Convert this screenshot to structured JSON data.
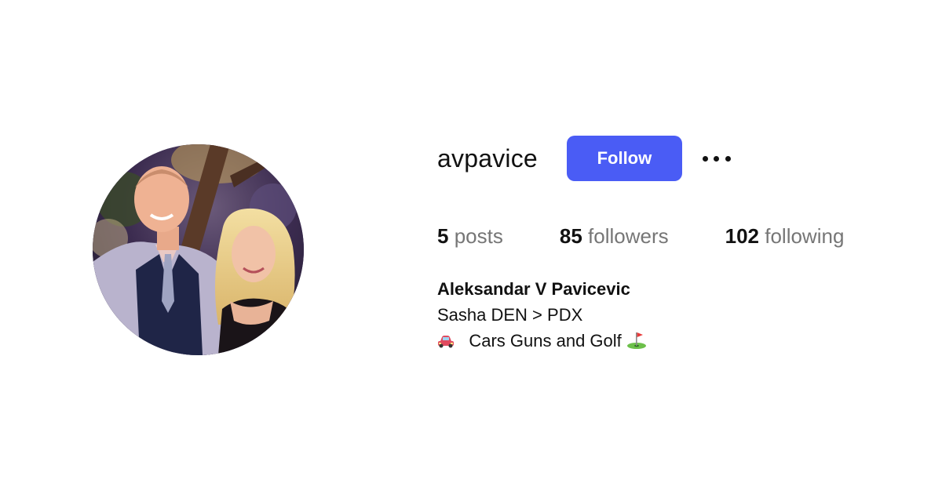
{
  "profile": {
    "username": "avpavice",
    "full_name": "Aleksandar V Pavicevic",
    "bio_line_1": "Sasha DEN > PDX",
    "bio_line_2": "Cars Guns and Golf",
    "bio_line_2_icons": [
      "car-icon",
      "golf-flag-icon"
    ]
  },
  "actions": {
    "follow_label": "Follow",
    "more_icon": "more-dots-icon"
  },
  "stats": {
    "posts": {
      "count": "5",
      "label": "posts"
    },
    "followers": {
      "count": "85",
      "label": "followers"
    },
    "following": {
      "count": "102",
      "label": "following"
    }
  },
  "colors": {
    "follow_button": "#4a5cf5",
    "secondary_text": "#767676",
    "primary_text": "#111111"
  }
}
